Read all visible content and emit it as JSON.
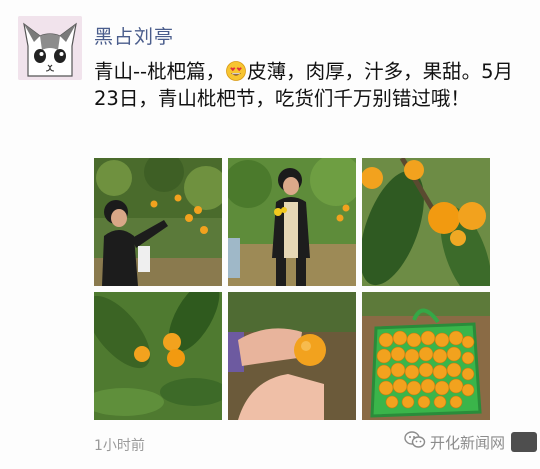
{
  "post": {
    "username": "黑占刘亭",
    "text_before_emoji": "青山--枇杷篇，",
    "emoji": "smiling-face-with-heart-eyes",
    "text_after_emoji": "皮薄，肉厚，汁多，果甜。5月23日，青山枇杷节，吃货们千万别错过哦！",
    "timestamp": "1小时前"
  },
  "photos": [
    {
      "name": "photo-woman-picking-loquats"
    },
    {
      "name": "photo-woman-in-orchard"
    },
    {
      "name": "photo-loquat-branch"
    },
    {
      "name": "photo-loquats-on-tree"
    },
    {
      "name": "photo-loquat-in-hand"
    },
    {
      "name": "photo-loquat-basket"
    }
  ],
  "watermark": {
    "text": "开化新闻网",
    "icon": "wechat-icon"
  },
  "colors": {
    "username": "#4a5d8c",
    "timestamp": "#9a9a9a",
    "loquat": "#f2a21e",
    "leaf": "#3f6b2c"
  }
}
